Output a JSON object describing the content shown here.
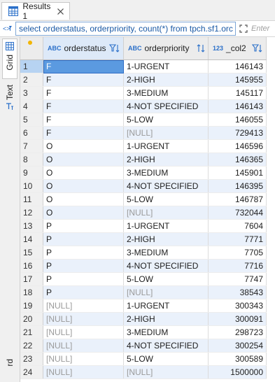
{
  "tab": {
    "title": "Results 1",
    "icon": "grid-table-icon"
  },
  "query": {
    "text": "select orderstatus, orderpriority, count(*) from tpch.sf1.orc",
    "hint": "Enter"
  },
  "sidebar": {
    "grid_label": "Grid",
    "text_label": "Text",
    "record_label": "rd"
  },
  "columns": [
    {
      "type": "ABC",
      "name": "orderstatus"
    },
    {
      "type": "ABC",
      "name": "orderpriority"
    },
    {
      "type": "123",
      "name": "_col2"
    }
  ],
  "rows": [
    {
      "n": "1",
      "status": "F",
      "priority": "1-URGENT",
      "count": "146143"
    },
    {
      "n": "2",
      "status": "F",
      "priority": "2-HIGH",
      "count": "145955"
    },
    {
      "n": "3",
      "status": "F",
      "priority": "3-MEDIUM",
      "count": "145117"
    },
    {
      "n": "4",
      "status": "F",
      "priority": "4-NOT SPECIFIED",
      "count": "146143"
    },
    {
      "n": "5",
      "status": "F",
      "priority": "5-LOW",
      "count": "146055"
    },
    {
      "n": "6",
      "status": "F",
      "priority": "[NULL]",
      "count": "729413"
    },
    {
      "n": "7",
      "status": "O",
      "priority": "1-URGENT",
      "count": "146596"
    },
    {
      "n": "8",
      "status": "O",
      "priority": "2-HIGH",
      "count": "146365"
    },
    {
      "n": "9",
      "status": "O",
      "priority": "3-MEDIUM",
      "count": "145901"
    },
    {
      "n": "10",
      "status": "O",
      "priority": "4-NOT SPECIFIED",
      "count": "146395"
    },
    {
      "n": "11",
      "status": "O",
      "priority": "5-LOW",
      "count": "146787"
    },
    {
      "n": "12",
      "status": "O",
      "priority": "[NULL]",
      "count": "732044"
    },
    {
      "n": "13",
      "status": "P",
      "priority": "1-URGENT",
      "count": "7604"
    },
    {
      "n": "14",
      "status": "P",
      "priority": "2-HIGH",
      "count": "7771"
    },
    {
      "n": "15",
      "status": "P",
      "priority": "3-MEDIUM",
      "count": "7705"
    },
    {
      "n": "16",
      "status": "P",
      "priority": "4-NOT SPECIFIED",
      "count": "7716"
    },
    {
      "n": "17",
      "status": "P",
      "priority": "5-LOW",
      "count": "7747"
    },
    {
      "n": "18",
      "status": "P",
      "priority": "[NULL]",
      "count": "38543"
    },
    {
      "n": "19",
      "status": "[NULL]",
      "priority": "1-URGENT",
      "count": "300343"
    },
    {
      "n": "20",
      "status": "[NULL]",
      "priority": "2-HIGH",
      "count": "300091"
    },
    {
      "n": "21",
      "status": "[NULL]",
      "priority": "3-MEDIUM",
      "count": "298723"
    },
    {
      "n": "22",
      "status": "[NULL]",
      "priority": "4-NOT SPECIFIED",
      "count": "300254"
    },
    {
      "n": "23",
      "status": "[NULL]",
      "priority": "5-LOW",
      "count": "300589"
    },
    {
      "n": "24",
      "status": "[NULL]",
      "priority": "[NULL]",
      "count": "1500000"
    }
  ],
  "colors": {
    "accent": "#2a6fc9",
    "selection": "#5b9ae0",
    "alt_row": "#eaf1fb",
    "null_text": "#9a9a9a"
  }
}
